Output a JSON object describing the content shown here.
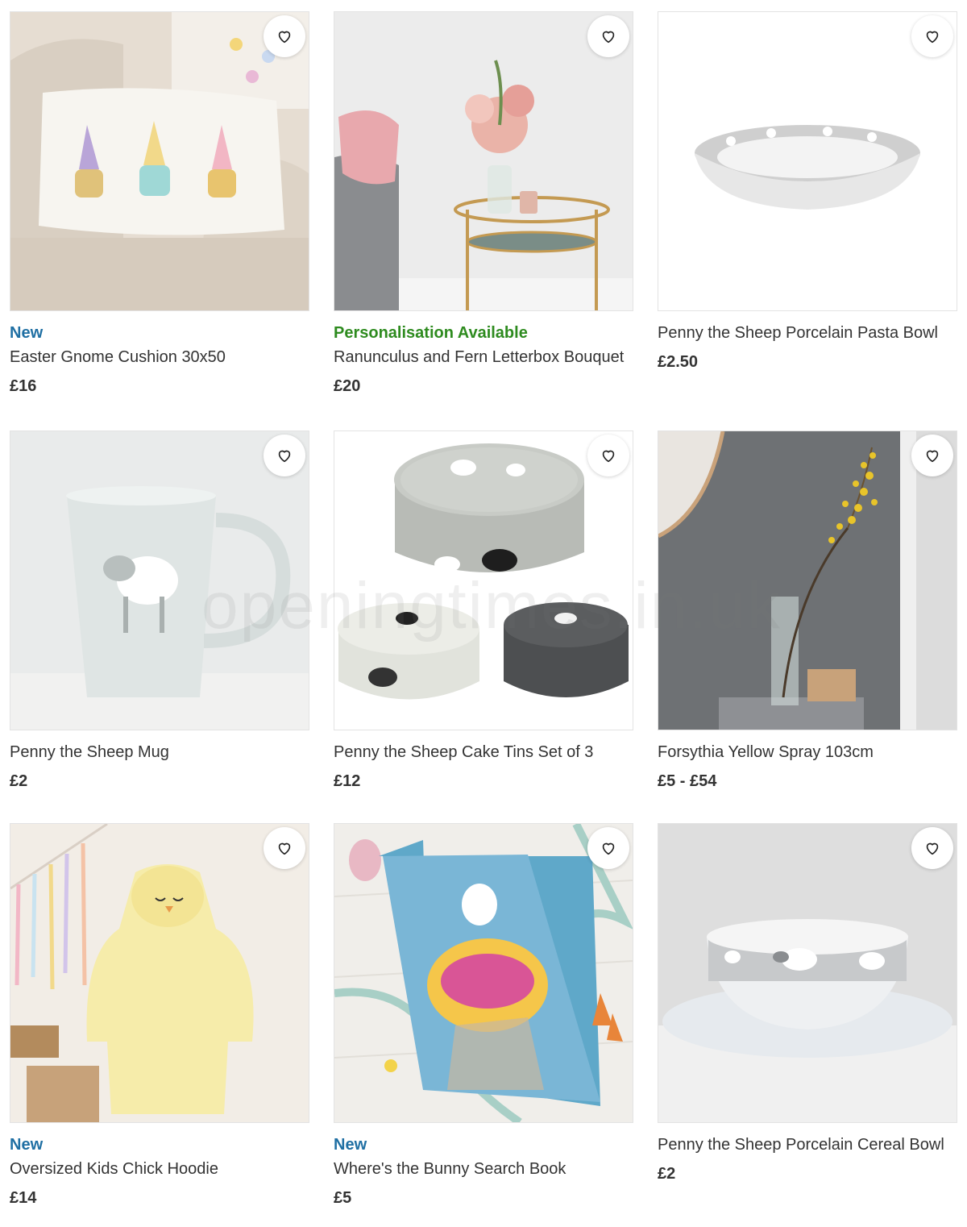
{
  "colors": {
    "badge_new": "#1f6fa3",
    "badge_personalisation": "#2e8b1f",
    "text": "#333333"
  },
  "favourite_icon": "heart-outline-icon",
  "watermark": "openingtimes.in.uk",
  "products": [
    {
      "badge": "New",
      "title": "Easter Gnome Cushion 30x50",
      "price": "£16"
    },
    {
      "badge": "Personalisation Available",
      "title": "Ranunculus and Fern Letterbox Bouquet",
      "price": "£20"
    },
    {
      "badge": "",
      "title": "Penny the Sheep Porcelain Pasta Bowl",
      "price": "£2.50"
    },
    {
      "badge": "",
      "title": "Penny the Sheep Mug",
      "price": "£2"
    },
    {
      "badge": "",
      "title": "Penny the Sheep Cake Tins Set of 3",
      "price": "£12"
    },
    {
      "badge": "",
      "title": "Forsythia Yellow Spray 103cm",
      "price": "£5 - £54"
    },
    {
      "badge": "New",
      "title": "Oversized Kids Chick Hoodie",
      "price": "£14"
    },
    {
      "badge": "New",
      "title": "Where's the Bunny Search Book",
      "price": "£5"
    },
    {
      "badge": "",
      "title": "Penny the Sheep Porcelain Cereal Bowl",
      "price": "£2"
    }
  ]
}
